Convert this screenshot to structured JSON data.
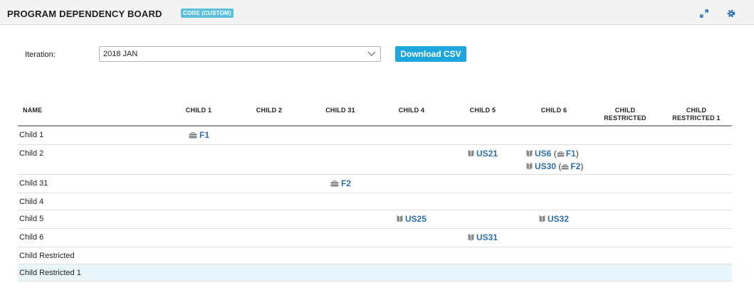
{
  "header": {
    "title": "PROGRAM DEPENDENCY BOARD",
    "badge": "CORE (CUSTOM)",
    "icons": [
      "expand-icon",
      "gear-icon"
    ]
  },
  "filters": {
    "iteration_label": "Iteration:",
    "iteration_value": "2018 JAN",
    "download_label": "Download CSV"
  },
  "colors": {
    "accent": "#1fa6df",
    "link": "#2d6fb1",
    "badge": "#5bc0de",
    "highlight_row": "#e9f6fb"
  },
  "table": {
    "columns": [
      "NAME",
      "CHILD 1",
      "CHILD 2",
      "CHILD 31",
      "CHILD 4",
      "CHILD 5",
      "CHILD 6",
      "CHILD RESTRICTED",
      "CHILD RESTRICTED 1"
    ],
    "rows": [
      {
        "name": "Child 1",
        "cells": {
          "1": [
            {
              "type": "feature",
              "id": "F1"
            }
          ]
        }
      },
      {
        "name": "Child 2",
        "cells": {
          "5": [
            {
              "type": "story",
              "id": "US21"
            }
          ],
          "6": [
            {
              "type": "story",
              "id": "US6",
              "parent": "F1"
            },
            {
              "type": "story",
              "id": "US30",
              "parent": "F2"
            }
          ]
        }
      },
      {
        "name": "Child 31",
        "cells": {
          "3": [
            {
              "type": "feature",
              "id": "F2"
            }
          ]
        }
      },
      {
        "name": "Child 4",
        "cells": {}
      },
      {
        "name": "Child 5",
        "cells": {
          "4": [
            {
              "type": "story",
              "id": "US25"
            }
          ],
          "6": [
            {
              "type": "story",
              "id": "US32"
            }
          ]
        }
      },
      {
        "name": "Child 6",
        "cells": {
          "5": [
            {
              "type": "story",
              "id": "US31"
            }
          ]
        }
      },
      {
        "name": "Child Restricted",
        "cells": {}
      },
      {
        "name": "Child Restricted 1",
        "cells": {},
        "highlighted": true
      }
    ]
  }
}
